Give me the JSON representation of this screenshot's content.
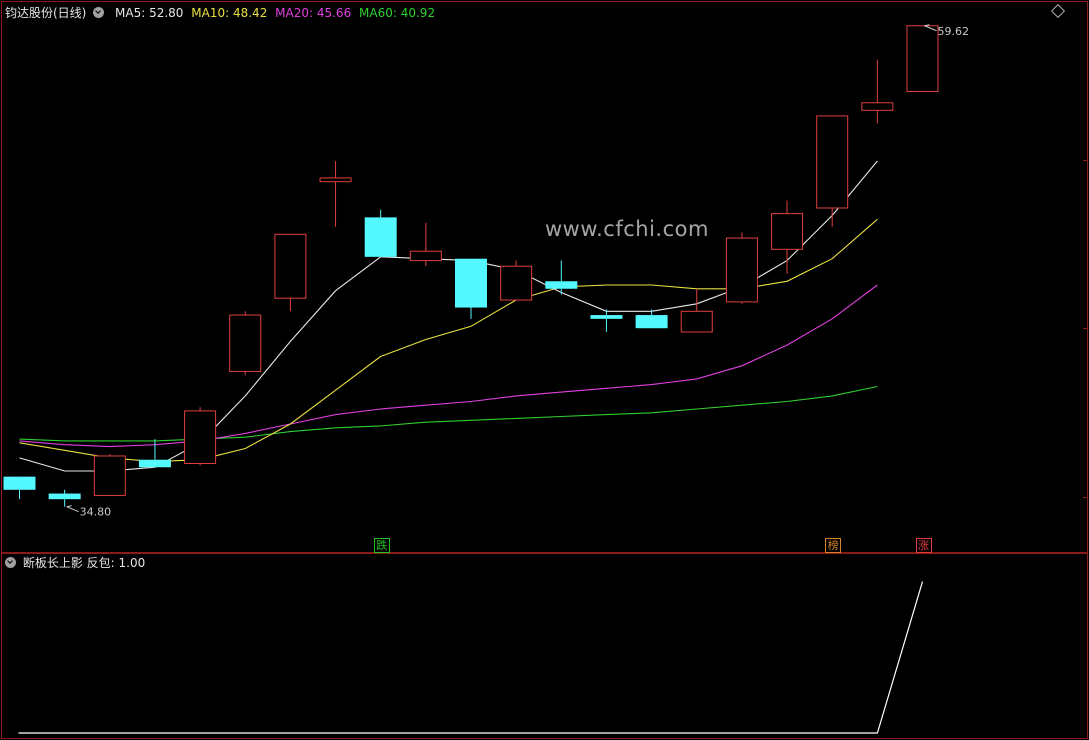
{
  "header": {
    "stock_name": "钧达股份(日线)",
    "ma5_label": "MA5: 52.80",
    "ma10_label": "MA10: 48.42",
    "ma20_label": "MA20: 45.66",
    "ma60_label": "MA60: 40.92"
  },
  "indicator_header": {
    "label": "断板长上影 反包: 1.00"
  },
  "watermark": "www.cfchi.com",
  "price_labels": {
    "high": "59.62",
    "low": "34.80"
  },
  "tags": [
    {
      "text": "跌",
      "color": "#22c222"
    },
    {
      "text": "榜",
      "color": "#d8832a"
    },
    {
      "text": "涨",
      "color": "#e03c3c"
    }
  ],
  "colors": {
    "up": "#e04040",
    "down": "#54f8ff",
    "ma5": "#e8e8e8",
    "ma10": "#e8e040",
    "ma20": "#e040e0",
    "ma60": "#30d030",
    "indicator": "#ffffff"
  },
  "chart_data": {
    "type": "candlestick",
    "ylim": [
      33.4,
      60.6
    ],
    "candles": [
      {
        "open": 36.4,
        "close": 35.7,
        "high": 36.3,
        "low": 35.2
      },
      {
        "open": 35.5,
        "close": 35.2,
        "high": 35.7,
        "low": 34.8
      },
      {
        "open": 35.4,
        "close": 37.5,
        "high": 37.6,
        "low": 35.4
      },
      {
        "open": 37.3,
        "close": 36.9,
        "high": 38.4,
        "low": 36.9
      },
      {
        "open": 37.1,
        "close": 39.9,
        "high": 40.1,
        "low": 37.0
      },
      {
        "open": 42.0,
        "close": 45.0,
        "high": 45.2,
        "low": 41.8
      },
      {
        "open": 45.9,
        "close": 49.3,
        "high": 49.3,
        "low": 45.2
      },
      {
        "open": 52.1,
        "close": 52.3,
        "high": 53.2,
        "low": 49.7
      },
      {
        "open": 50.2,
        "close": 48.1,
        "high": 50.6,
        "low": 48.1
      },
      {
        "open": 47.9,
        "close": 48.4,
        "high": 49.9,
        "low": 47.6
      },
      {
        "open": 48.0,
        "close": 45.4,
        "high": 48.0,
        "low": 44.8
      },
      {
        "open": 45.8,
        "close": 47.6,
        "high": 47.9,
        "low": 45.8
      },
      {
        "open": 46.8,
        "close": 46.4,
        "high": 47.9,
        "low": 46.1
      },
      {
        "open": 45.0,
        "close": 44.8,
        "high": 45.3,
        "low": 44.1
      },
      {
        "open": 45.0,
        "close": 44.3,
        "high": 45.3,
        "low": 44.3
      },
      {
        "open": 44.1,
        "close": 45.2,
        "high": 46.4,
        "low": 44.1
      },
      {
        "open": 45.7,
        "close": 49.1,
        "high": 49.4,
        "low": 45.6
      },
      {
        "open": 48.5,
        "close": 50.4,
        "high": 51.1,
        "low": 47.2
      },
      {
        "open": 50.7,
        "close": 55.6,
        "high": 55.6,
        "low": 49.7
      },
      {
        "open": 55.9,
        "close": 56.3,
        "high": 58.6,
        "low": 55.2
      },
      {
        "open": 56.9,
        "close": 60.4,
        "high": 60.4,
        "low": 56.9
      }
    ],
    "ma5": [
      37.4,
      36.7,
      36.7,
      36.9,
      38.2,
      40.7,
      43.6,
      46.3,
      48.1,
      48.0,
      47.9,
      47.4,
      46.2,
      45.2,
      45.2,
      45.6,
      46.5,
      47.9,
      50.3,
      53.2
    ],
    "ma10": [
      38.2,
      37.8,
      37.4,
      37.2,
      37.3,
      37.9,
      39.2,
      41.0,
      42.8,
      43.7,
      44.4,
      45.8,
      46.5,
      46.6,
      46.6,
      46.4,
      46.4,
      46.8,
      48.0,
      50.1
    ],
    "ma20": [
      38.3,
      38.1,
      38.0,
      38.1,
      38.3,
      38.7,
      39.2,
      39.7,
      40.0,
      40.2,
      40.4,
      40.7,
      40.9,
      41.1,
      41.3,
      41.6,
      42.3,
      43.4,
      44.8,
      46.6
    ],
    "ma60": [
      38.4,
      38.3,
      38.3,
      38.3,
      38.4,
      38.5,
      38.8,
      39.0,
      39.1,
      39.3,
      39.4,
      39.5,
      39.6,
      39.7,
      39.8,
      40.0,
      40.2,
      40.4,
      40.7,
      41.2
    ],
    "tag_candle_index": [
      8,
      18,
      20
    ],
    "indicator": {
      "name": "断板长上影 反包",
      "ylim": [
        0,
        1.05
      ],
      "values": [
        0,
        0,
        0,
        0,
        0,
        0,
        0,
        0,
        0,
        0,
        0,
        0,
        0,
        0,
        0,
        0,
        0,
        0,
        0,
        0,
        1
      ]
    }
  }
}
